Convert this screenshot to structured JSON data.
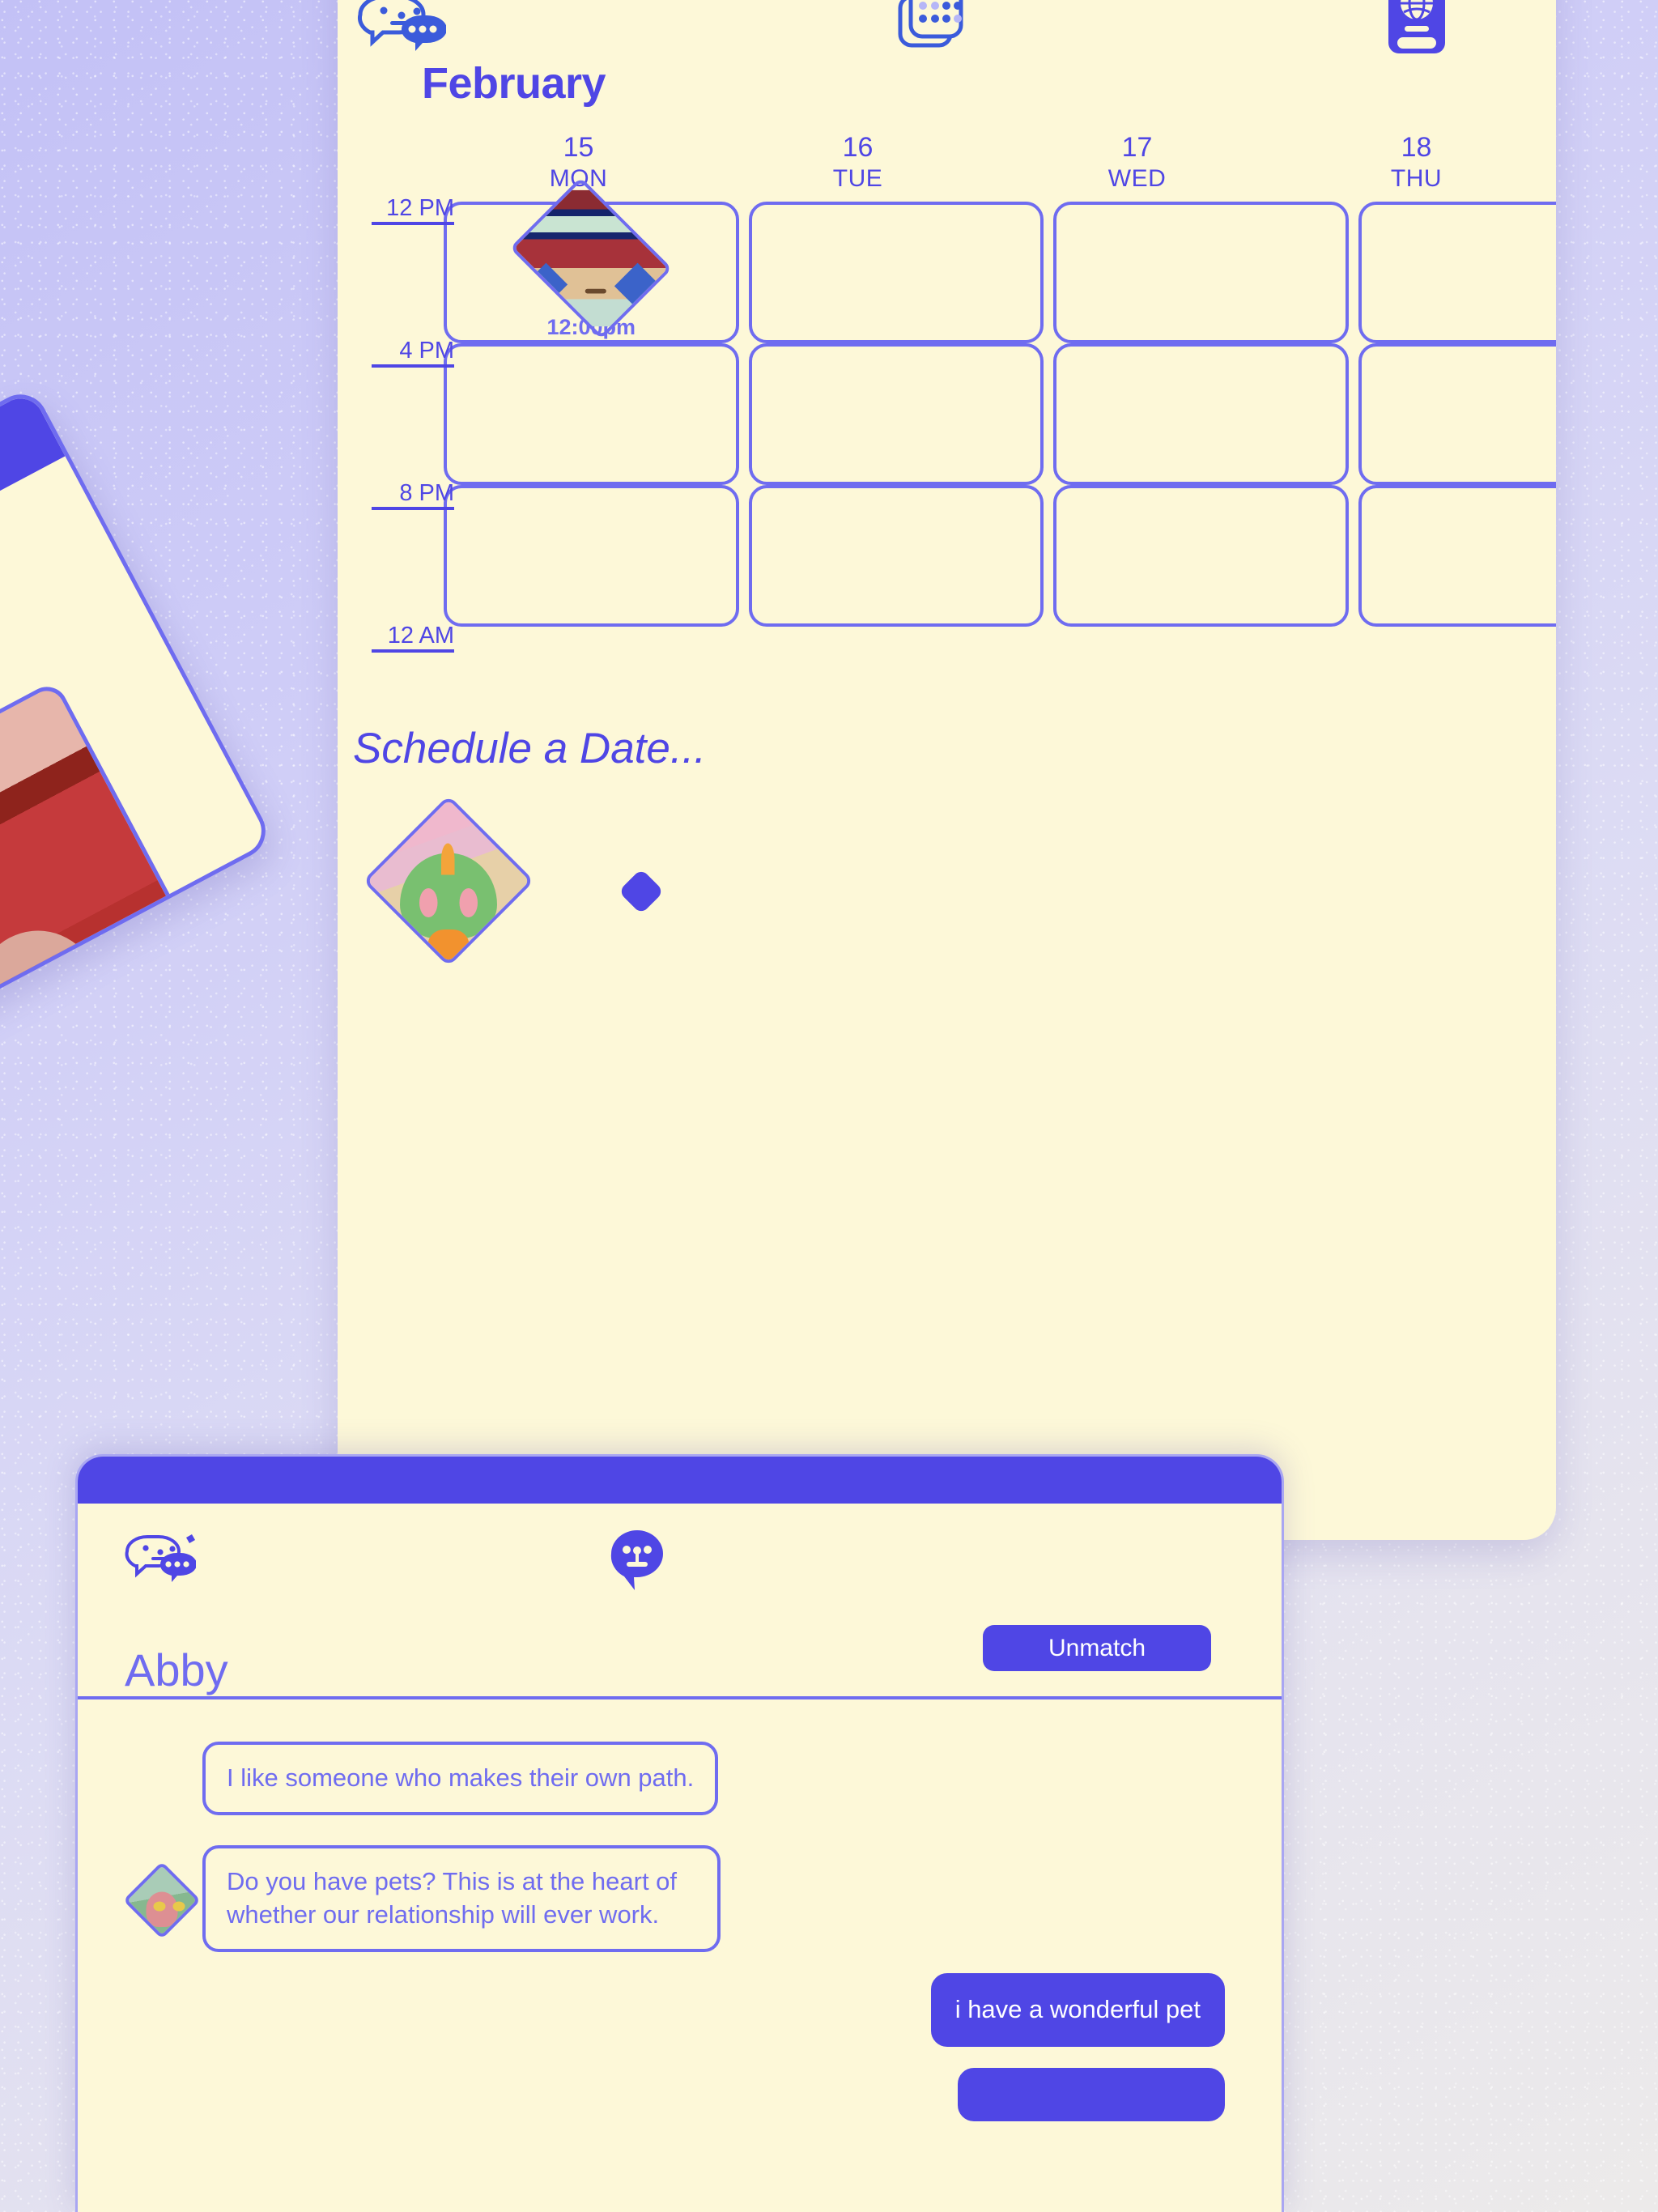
{
  "theme": {
    "paper": "#fdf8d8",
    "accent": "#4f46e5",
    "accent_light": "#6f6cf0",
    "desktop": "#c7c6f5",
    "text_on_accent": "#ffffff"
  },
  "calendar_window": {
    "toolbar": {
      "chat_icon": "chat-bubbles-icon",
      "calendar_icon": "calendar-icon",
      "passport_icon": "passport-globe-icon"
    },
    "month": "February",
    "days": [
      {
        "num": "15",
        "name": "MON"
      },
      {
        "num": "16",
        "name": "TUE"
      },
      {
        "num": "17",
        "name": "WED"
      },
      {
        "num": "18",
        "name": "THU"
      }
    ],
    "hour_labels": [
      "12 PM",
      "4 PM",
      "8 PM",
      "12 AM"
    ],
    "events": [
      {
        "day_index": 0,
        "row_index": 0,
        "time": "12:00pm",
        "avatar": "red-hair-face-avatar"
      }
    ],
    "schedule_label": "Schedule a Date...",
    "schedule_avatar": "green-alien-avatar"
  },
  "chat_window": {
    "toolbar": {
      "chat_icon": "chat-bubbles-icon",
      "face_icon": "face-bubble-icon"
    },
    "contact_name": "Abby",
    "unmatch_label": "Unmatch",
    "messages": [
      {
        "from": "them",
        "text": "I like someone who makes their own path.",
        "has_avatar": false
      },
      {
        "from": "them",
        "text": "Do you have pets? This is at the heart of whether our relationship will ever work.",
        "has_avatar": true,
        "avatar": "pink-green-creature-avatar"
      },
      {
        "from": "me",
        "text": "i have a wonderful pet",
        "has_avatar": false
      },
      {
        "from": "me",
        "text": "",
        "has_avatar": false,
        "partial": true
      }
    ]
  }
}
